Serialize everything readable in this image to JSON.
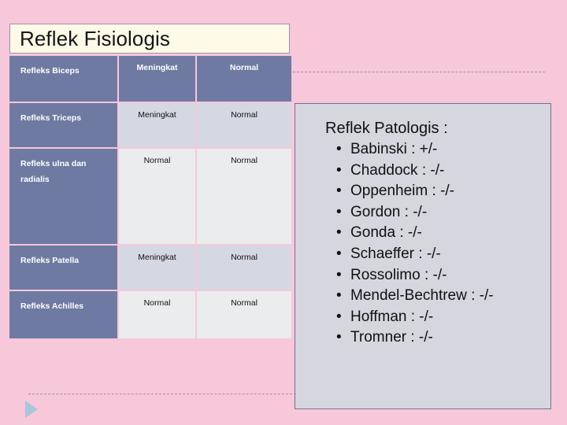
{
  "slide": {
    "title": "Reflek Fisiologis",
    "background_color": "#f7c7da",
    "accent_color": "#6f7aa3"
  },
  "table": {
    "name": "reflex-fisiologis-table",
    "rows": [
      {
        "label": "Refleks Biceps",
        "col2": "Meningkat",
        "col3": "Normal",
        "band": "header"
      },
      {
        "label": "Refleks Triceps",
        "col2": "Meningkat",
        "col3": "Normal",
        "band": "dark"
      },
      {
        "label": "Refleks ulna dan radialis",
        "col2": "Normal",
        "col3": "Normal",
        "band": "light"
      },
      {
        "label": "Refleks Patella",
        "col2": "Meningkat",
        "col3": "Normal",
        "band": "dark"
      },
      {
        "label": "Refleks Achilles",
        "col2": "Normal",
        "col3": "Normal",
        "band": "light"
      }
    ]
  },
  "patologis": {
    "heading": "Reflek Patologis :",
    "bullet_glyph": "•",
    "items": [
      "Babinski : +/-",
      "Chaddock : -/-",
      "Oppenheim : -/-",
      "Gordon : -/-",
      "Gonda : -/-",
      "Schaeffer : -/-",
      "Rossolimo : -/-",
      "Mendel-Bechtrew : -/-",
      "Hoffman : -/-",
      "Tromner : -/-"
    ]
  },
  "decorations": {
    "play_icon": "play-triangle-icon",
    "dash_top": "dashed-connector-top",
    "dash_bottom": "dashed-connector-bottom"
  }
}
